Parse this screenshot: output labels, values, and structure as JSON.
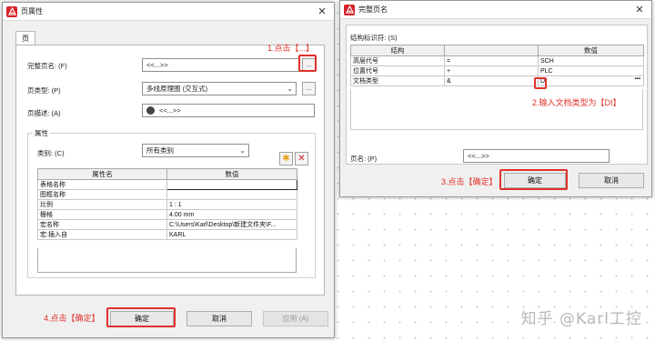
{
  "left_dialog": {
    "title": "页属性",
    "tab": "页",
    "full_page_name_label": "完整页名: (F)",
    "full_page_name_value": "<<...>>",
    "browse_btn": "...",
    "page_type_label": "页类型: (P)",
    "page_type_value": "多线原理图 (交互式)",
    "page_desc_label": "页描述: (A)",
    "page_desc_value": "<<...>>",
    "attributes_group": "属性",
    "category_label": "类别: (C)",
    "category_value": "所有类别",
    "table_headers": [
      "属性名",
      "数值"
    ],
    "table_rows": [
      [
        "表格名称",
        ""
      ],
      [
        "图框名称",
        ""
      ],
      [
        "比例",
        "1 : 1"
      ],
      [
        "栅格",
        "4.00 mm"
      ],
      [
        "宏名称",
        "C:\\Users\\Karl\\Desktop\\新建文件夹\\F..."
      ],
      [
        "宏:插入自",
        "KARL"
      ]
    ],
    "ok_label": "确定",
    "cancel_label": "取消",
    "apply_label": "应用 (A)"
  },
  "right_dialog": {
    "title": "完整页名",
    "structure_label": "结构标识符: (S)",
    "table_headers": [
      "结构",
      "",
      "数值"
    ],
    "table_rows": [
      [
        "高层代号",
        "=",
        "SCH"
      ],
      [
        "位置代号",
        "+",
        "PLC"
      ],
      [
        "文档类型",
        "&",
        "DI"
      ]
    ],
    "page_name_label": "页名: (P)",
    "page_name_value": "<<...>>",
    "ok_label": "确定",
    "cancel_label": "取消"
  },
  "annotations": {
    "step1": "1.点击【...】",
    "step2": "2.输入文档类型为【DI】",
    "step3": "3.点击【确定】",
    "step4": "4.点击【确定】"
  },
  "watermark": "知乎 @Karl工控",
  "colors": {
    "annotation": "#e0312b",
    "app_icon": "#d5242b"
  }
}
